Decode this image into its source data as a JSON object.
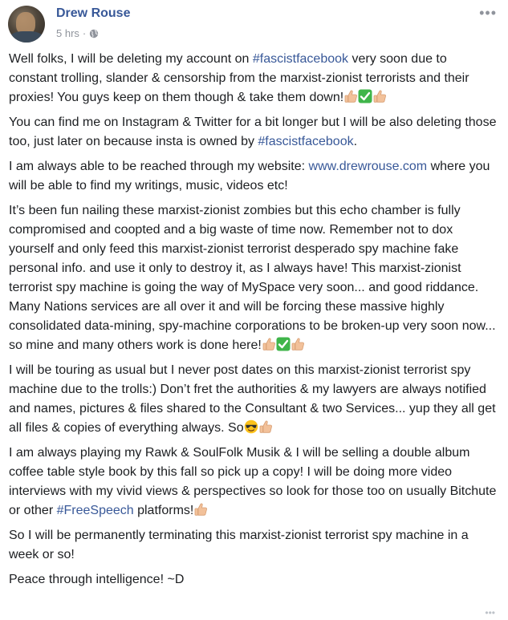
{
  "post": {
    "author": "Drew Rouse",
    "time": "5 hrs",
    "separator": "·",
    "privacy_icon": "globe-icon",
    "more_icon": "more-horizontal-icon",
    "p1": {
      "a": "Well folks, I will be deleting my account on ",
      "tag": "#fascistfacebook",
      "b": " very soon due to constant trolling, slander & censorship from the marxist-zionist terrorists and their proxies! You guys keep on them though & take them down!"
    },
    "p2": {
      "a": "You can find me on Instagram & Twitter for a bit longer but I will be also deleting those too, just later on because insta is owned by ",
      "tag": "#fascistfacebook",
      "b": "."
    },
    "p3": {
      "a": "I am always able to be reached through my website: ",
      "link": "www.drewrouse.com",
      "b": " where you will be able to find my writings, music, videos etc!"
    },
    "p4": {
      "a": "It’s been fun nailing these marxist-zionist zombies but this echo chamber is fully compromised and coopted and a big waste of time now. Remember not to dox yourself and only feed this marxist-zionist terrorist desperado spy machine fake personal info. and use it only to destroy it, as I always have! This marxist-zionist terrorist spy machine is going the way of MySpace very soon... and good riddance. Many Nations services are all over it and will be forcing these massive highly consolidated data-mining, spy-machine corporations to be broken-up very soon now... so mine and many others work is done here!"
    },
    "p5": {
      "a": "I will be touring as usual but I never post dates on this marxist-zionist terrorist spy machine due to the trolls:) Don’t fret the authorities & my lawyers are always notified and names, pictures & files shared to the Consultant & two Services... yup they all get all files & copies of everything always. So"
    },
    "p6": {
      "a": "I am always playing my Rawk & SoulFolk Musik & I will be selling a double album coffee table style book by this fall so pick up a copy! I will be doing more video interviews with my vivid views & perspectives so look for those too on usually Bitchute or other ",
      "tag": "#FreeSpeech",
      "b": " platforms!"
    },
    "p7": "So I will be permanently terminating this marxist-zionist terrorist spy machine in a week or so!",
    "p8": "Peace through intelligence! ~D",
    "emojis": [
      "thumbs-up-emoji",
      "check-mark-emoji",
      "sunglasses-emoji"
    ],
    "bottom_more": "•••"
  }
}
